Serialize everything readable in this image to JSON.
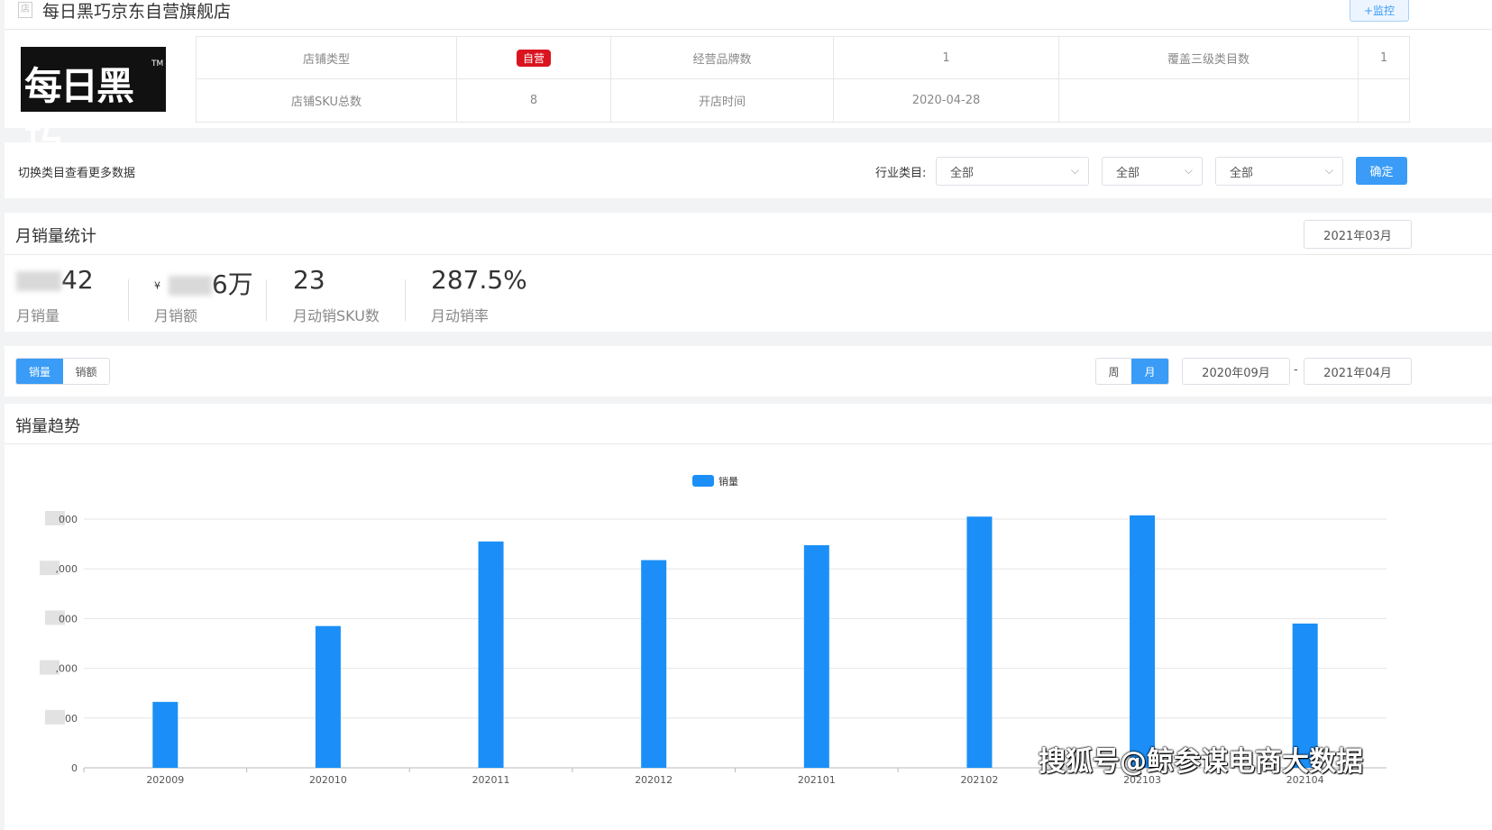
{
  "store": {
    "title": "每日黑巧京东自营旗舰店",
    "monitor_button": "+监控",
    "logo_text": "每日黑巧",
    "logo_tm": "TM"
  },
  "info_table": {
    "row1": {
      "label1": "店铺类型",
      "value1": "自营",
      "label2": "经营品牌数",
      "value2": "1",
      "label3": "覆盖三级类目数",
      "value3": "1"
    },
    "row2": {
      "label1": "店铺SKU总数",
      "value1": "8",
      "label2": "开店时间",
      "value2": "2020-04-28"
    }
  },
  "filter": {
    "hint": "切换类目查看更多数据",
    "industry_label": "行业类目:",
    "select1": "全部",
    "select2": "全部",
    "select3": "全部",
    "confirm": "确定"
  },
  "monthly": {
    "title": "月销量统计",
    "month": "2021年03月",
    "stats": [
      {
        "value_suffix": "42",
        "label": "月销量"
      },
      {
        "currency": "¥",
        "value_suffix": "6万",
        "label": "月销额"
      },
      {
        "value": "23",
        "label": "月动销SKU数"
      },
      {
        "value": "287.5%",
        "label": "月动销率"
      }
    ]
  },
  "toggles": {
    "metric": [
      "销量",
      "销额"
    ],
    "period": [
      "周",
      "月"
    ],
    "date_from": "2020年09月",
    "date_sep": "-",
    "date_to": "2021年04月"
  },
  "trend": {
    "title": "销量趋势"
  },
  "chart_data": {
    "type": "bar",
    "title": "",
    "legend": [
      "销量"
    ],
    "legend_position": "top-center",
    "categories": [
      "202009",
      "202010",
      "202011",
      "202012",
      "202101",
      "202102",
      "202103",
      "202104"
    ],
    "series": [
      {
        "name": "销量",
        "values": [
          0.265,
          0.57,
          0.91,
          0.835,
          0.895,
          1.01,
          1.015,
          0.58
        ],
        "color": "#1b8ff7"
      }
    ],
    "y_ticks_visible": [
      "0",
      "00",
      ",000",
      "000",
      ",000",
      "000"
    ],
    "ylim": [
      0,
      1.0
    ],
    "y_note": "y-axis tick labels partially obscured; values are relative to top gridline",
    "grid": true
  },
  "watermark": "搜狐号@鲸参谋电商大数据",
  "colors": {
    "accent": "#3a9cf6",
    "bar": "#1b8ff7",
    "badge_red": "#d9141f"
  }
}
